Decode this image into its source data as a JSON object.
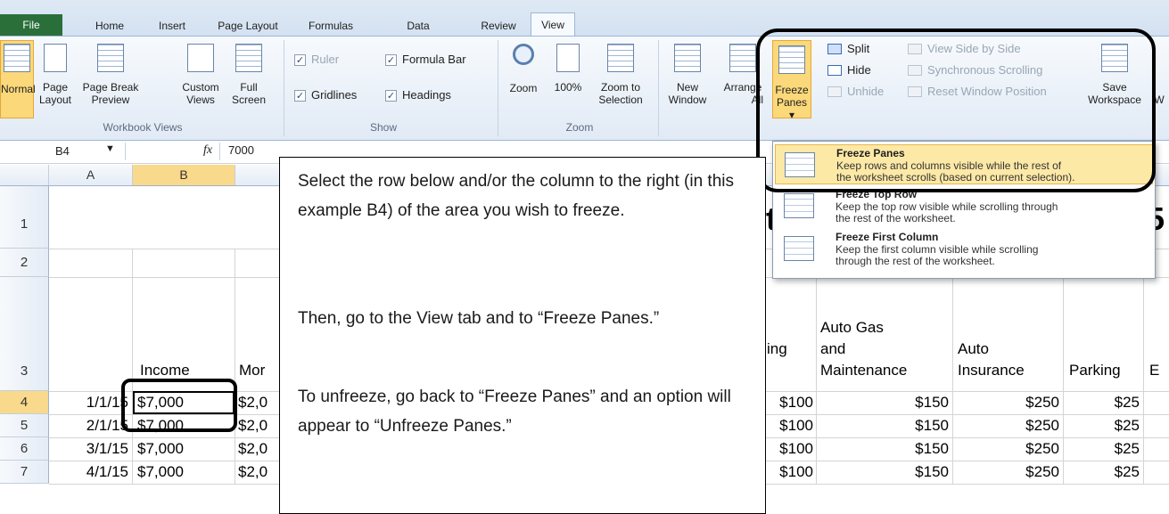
{
  "tabs": [
    "File",
    "Home",
    "Insert",
    "Page Layout",
    "Formulas",
    "Data",
    "Review",
    "View"
  ],
  "active_tab": "View",
  "ribbon": {
    "workbook_views": {
      "label": "Workbook Views",
      "normal": "Normal",
      "page_layout": [
        "Page",
        "Layout"
      ],
      "page_break": [
        "Page Break",
        "Preview"
      ],
      "custom_views": [
        "Custom",
        "Views"
      ],
      "full_screen": [
        "Full",
        "Screen"
      ]
    },
    "show": {
      "label": "Show",
      "ruler": "Ruler",
      "formula_bar": "Formula Bar",
      "gridlines": "Gridlines",
      "headings": "Headings"
    },
    "zoom": {
      "label": "Zoom",
      "zoom": "Zoom",
      "hundred": "100%",
      "zoom_to_selection": [
        "Zoom to",
        "Selection"
      ]
    },
    "window": {
      "new_window": [
        "New",
        "Window"
      ],
      "arrange_all": [
        "Arrange",
        "All"
      ],
      "freeze_panes": [
        "Freeze",
        "Panes ▾"
      ],
      "split": "Split",
      "hide": "Hide",
      "unhide": "Unhide",
      "view_side_by_side": "View Side by Side",
      "sync_scrolling": "Synchronous Scrolling",
      "reset_window": "Reset Window Position",
      "save_workspace": [
        "Save",
        "Workspace"
      ],
      "switch": "W"
    }
  },
  "formula_bar": {
    "name_box": "B4",
    "fx": "fx",
    "value": "7000"
  },
  "columns": [
    "A",
    "B"
  ],
  "rows": [
    "1",
    "2",
    "3",
    "4",
    "5",
    "6",
    "7"
  ],
  "sheet": {
    "row1_fragments": [
      "t",
      "5"
    ],
    "header_income": "Income",
    "header_mor": "Mor",
    "header_ing": "ing",
    "header_auto_gas": [
      "Auto Gas",
      "and",
      "Maintenance"
    ],
    "header_auto_ins": [
      "Auto",
      "Insurance"
    ],
    "header_parking": "Parking",
    "header_e": "E",
    "data": [
      {
        "a": "1/1/15",
        "b": "$7,000",
        "c": "$2,0",
        "f": "$100",
        "g": "$150",
        "h": "$250",
        "i": "$25"
      },
      {
        "a": "2/1/15",
        "b": "$7,000",
        "c": "$2,0",
        "f": "$100",
        "g": "$150",
        "h": "$250",
        "i": "$25"
      },
      {
        "a": "3/1/15",
        "b": "$7,000",
        "c": "$2,0",
        "f": "$100",
        "g": "$150",
        "h": "$250",
        "i": "$25"
      },
      {
        "a": "4/1/15",
        "b": "$7,000",
        "c": "$2,0",
        "f": "$100",
        "g": "$150",
        "h": "$250",
        "i": "$25"
      }
    ]
  },
  "callout": [
    "Select the row below and/or the column to the right (in this example B4) of the area you wish to freeze.",
    "Then, go to the View tab and to “Freeze Panes.”",
    "To unfreeze, go back to “Freeze Panes” and an option will appear to “Unfreeze Panes.”"
  ],
  "dropdown": [
    {
      "title": "Freeze Panes",
      "desc": [
        "Keep rows and columns visible while the rest of",
        "the worksheet scrolls (based on current selection)."
      ]
    },
    {
      "title": "Freeze Top Row",
      "desc": [
        "Keep the top row visible while scrolling through",
        "the rest of the worksheet."
      ]
    },
    {
      "title": "Freeze First Column",
      "desc": [
        "Keep the first column visible while scrolling",
        "through the rest of the worksheet."
      ]
    }
  ]
}
